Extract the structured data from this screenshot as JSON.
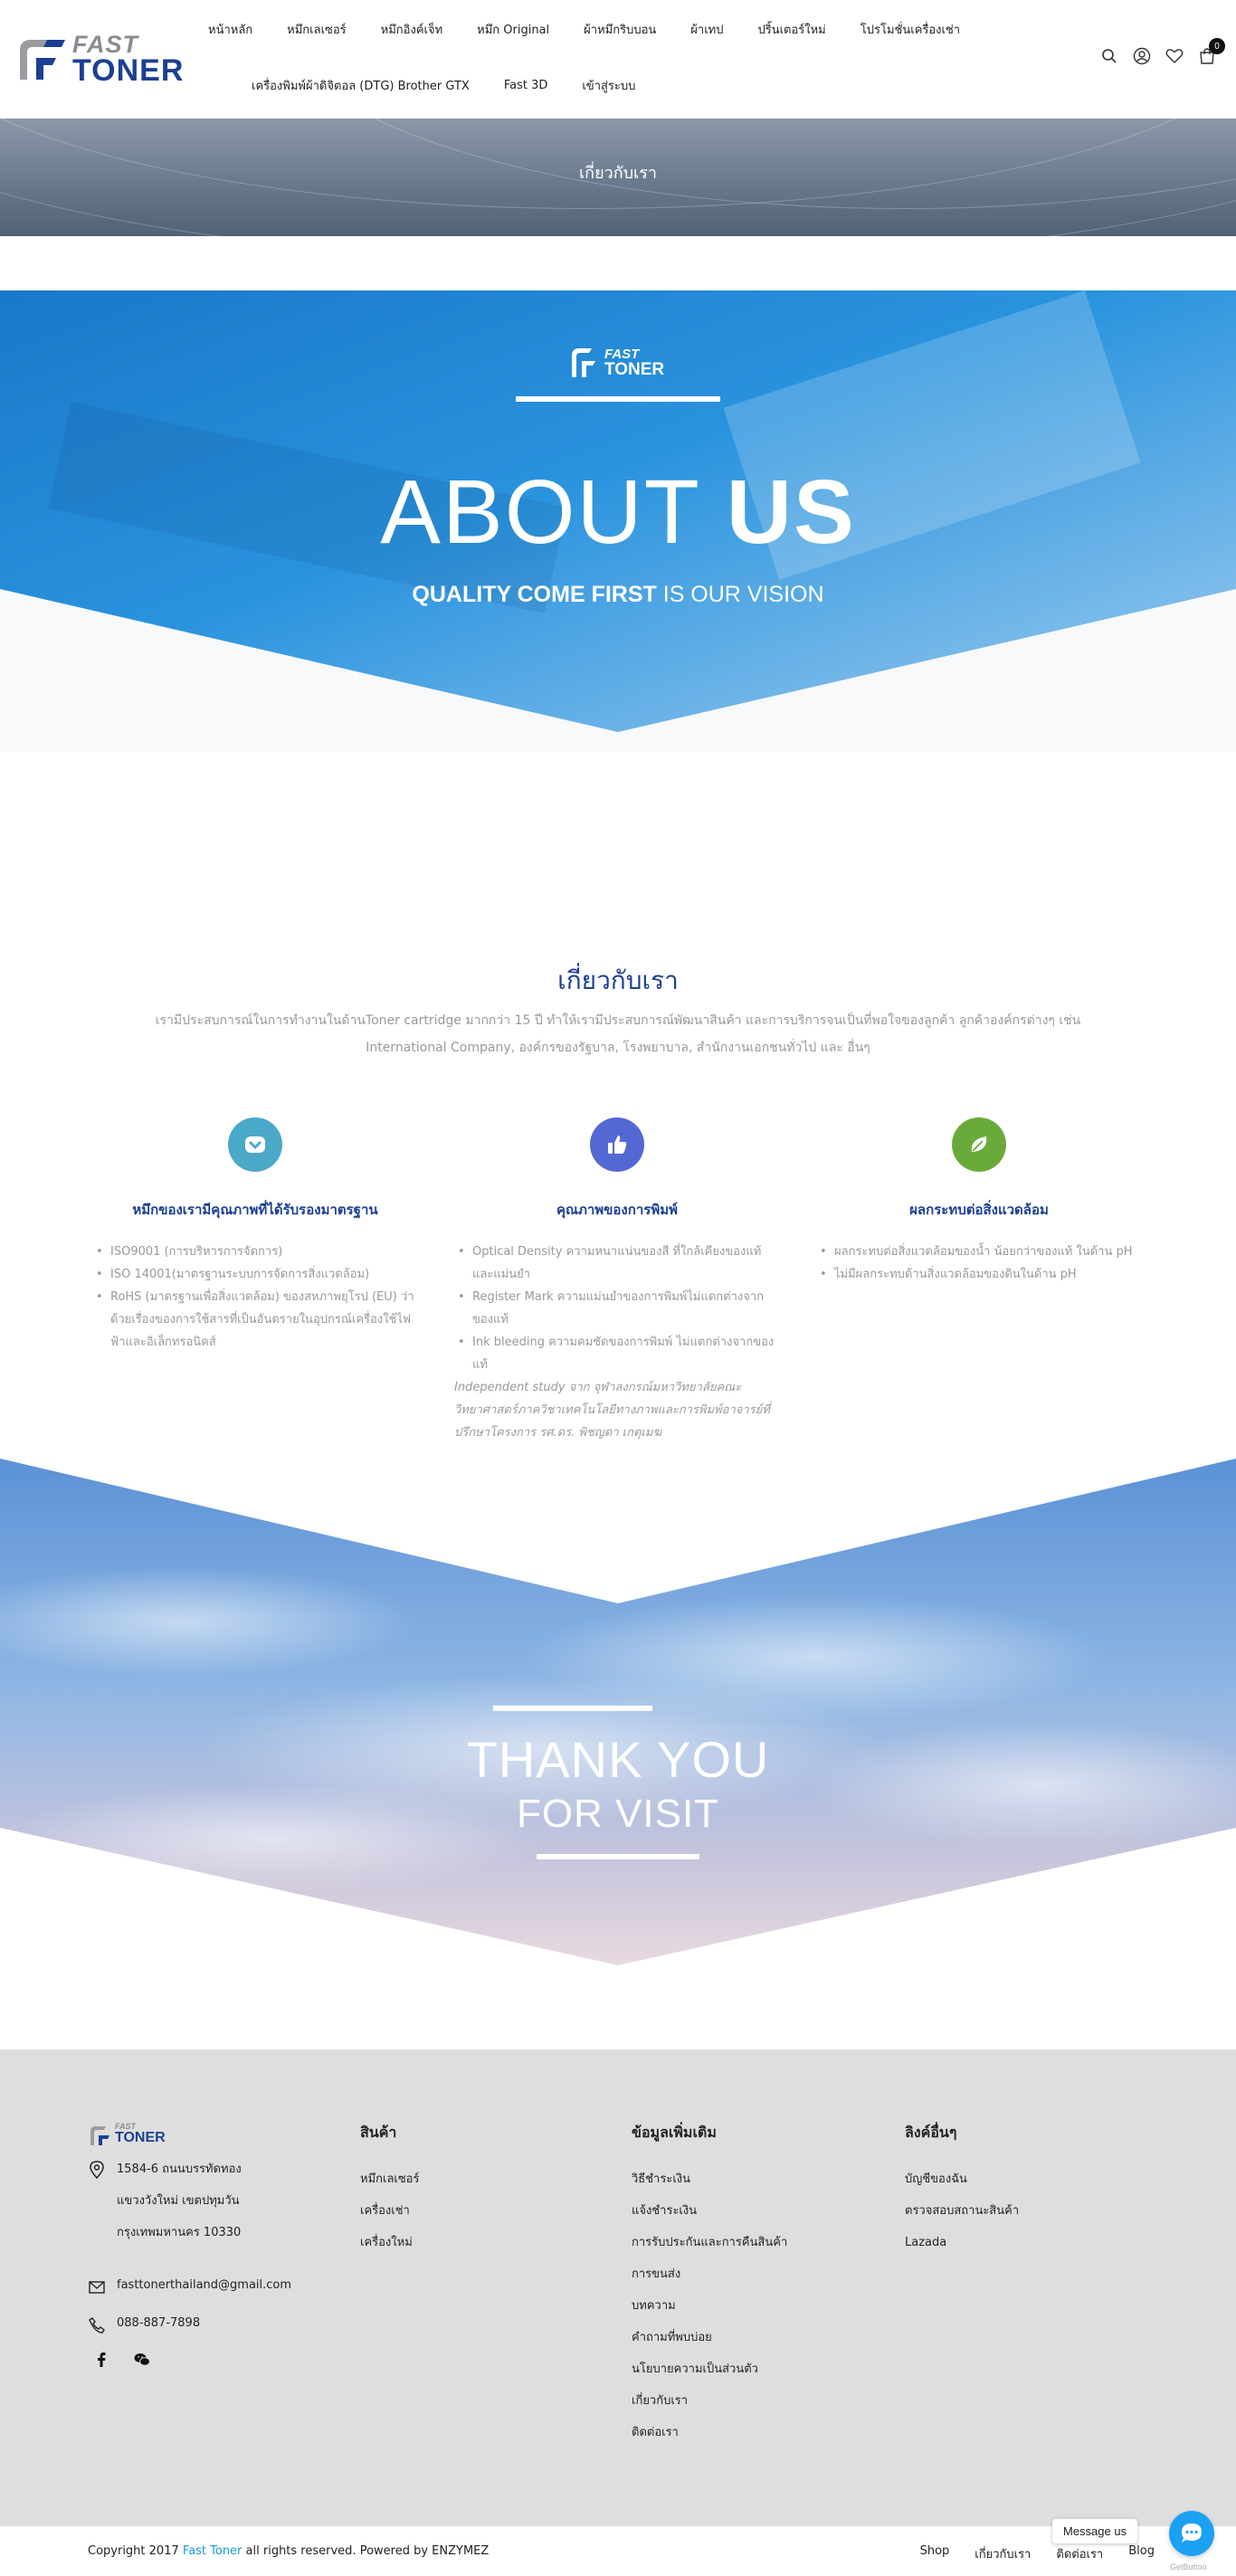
{
  "header": {
    "logo": {
      "fast": "FAST",
      "toner": "TONER"
    },
    "nav_row1": [
      "หน้าหลัก",
      "หมึกเลเซอร์",
      "หมึกอิงค์เจ็ท",
      "หมึก Original",
      "ผ้าหมึกริบบอน",
      "ผ้าเทป",
      "ปริ้นเตอร์ใหม่",
      "โปรโมชั่นเครื่องเช่า"
    ],
    "nav_row2": [
      "เครื่องพิมพ์ผ้าดิจิตอล (DTG) Brother GTX",
      "Fast 3D",
      "เข้าสู่ระบบ"
    ],
    "cart_count": "0",
    "icons": [
      "search-icon",
      "user-icon",
      "heart-icon",
      "cart-icon"
    ]
  },
  "page_title": "เกี่ยวกับเรา",
  "about_banner": {
    "logo": {
      "fast": "FAST",
      "toner": "TONER"
    },
    "title_light": "ABOUT ",
    "title_bold": "US",
    "sub_bold": "QUALITY COME FIRST",
    "sub_light": " IS OUR VISION"
  },
  "about": {
    "title": "เกี่ยวกับเรา",
    "description": "เรามีประสบการณ์ในการทำงานในด้านToner cartridge มากกว่า 15 ปี ทำให้เรามีประสบการณ์พัฒนาสินค้า และการบริการจนเป็นที่พอใจของลูกค้า ลูกค้าองค์กรต่างๆ เช่น International Company, องค์กรของรัฐบาล, โรงพยาบาล, สำนักงานเอกชนทั่วไป และ อื่นๆ",
    "features": [
      {
        "icon": "shield-check-icon",
        "color": "#4aa9c9",
        "title": "หมึกของเรามีคุณภาพที่ได้รับรองมาตรฐาน",
        "items": [
          "ISO9001 (การบริหารการจัดการ)",
          "ISO 14001(มาตรฐานระบบการจัดการสิ่งแวดล้อม)",
          "RoHS (มาตรฐานเพื่อสิ่งแวดล้อม) ของสหภาพยุโรป (EU) ว่าด้วยเรื่องของการใช้สารที่เป็นอันตรายในอุปกรณ์เครื่องใช้ไฟฟ้าและอิเล็กทรอนิคส์"
        ],
        "note": ""
      },
      {
        "icon": "thumbs-up-icon",
        "color": "#5468d4",
        "title": "คุณภาพของการพิมพ์",
        "items": [
          "Optical Density ความหนาแน่นของสี ที่ใกล้เคียงของแท้ และแม่นยำ",
          "Register Mark ความแม่นยำของการพิมพ์ไม่แตกต่างจากของแท้",
          "Ink bleeding ความคมชัดของการพิมพ์ ไม่แตกต่างจากของแท้"
        ],
        "note": "Independent study จาก จุฬาลงกรณ์มหาวิทยาลัยคณะวิทยาศาสตร์ภาควิชาเทคโนโลยีทางภาพและการพิมพ์อาจารย์ที่ปรึกษาโครงการ รศ.ดร. พิชญดา เกตุเมฆ"
      },
      {
        "icon": "leaf-icon",
        "color": "#6aaa3a",
        "title": "ผลกระทบต่อสิ่งแวดล้อม",
        "items": [
          "ผลกระทบต่อสิ่งแวดล้อมของน้ำ น้อยกว่าของแท้ ในด้าน pH",
          "ไม่มีผลกระทบด้านสิ่งแวดล้อมของดินในด้าน pH"
        ],
        "note": ""
      }
    ]
  },
  "thanks": {
    "title": "THANK YOU",
    "sub": "FOR VISIT"
  },
  "footer": {
    "logo": {
      "fast": "FAST",
      "toner": "TONER"
    },
    "address_lines": [
      "1584-6 ถนนบรรทัดทอง",
      "แขวงวังใหม่ เขตปทุมวัน",
      "กรุงเทพมหานคร 10330"
    ],
    "email": "fasttonerthailand@gmail.com",
    "phone": "088-887-7898",
    "social": [
      "facebook-icon",
      "wechat-icon"
    ],
    "columns": [
      {
        "title": "สินค้า",
        "links": [
          "หมึกเลเซอร์",
          "เครื่องเช่า",
          "เครื่องใหม่"
        ]
      },
      {
        "title": "ข้อมูลเพิ่มเติม",
        "links": [
          "วิธีชำระเงิน",
          "แจ้งชำระเงิน",
          "การรับประกันและการคืนสินค้า",
          "การขนส่ง",
          "บทความ",
          "คำถามที่พบบ่อย",
          "นโยบายความเป็นส่วนตัว",
          "เกี่ยวกับเรา",
          "ติดต่อเรา"
        ]
      },
      {
        "title": "ลิงค์อื่นๆ",
        "links": [
          "บัญชีของฉัน",
          "ตรวจสอบสถานะสินค้า",
          "Lazada"
        ]
      }
    ]
  },
  "bottom": {
    "copyright_prefix": "Copyright 2017 ",
    "copyright_brand": "Fast Toner",
    "copyright_suffix": " all rights reserved. Powered by ENZYMEZ",
    "links": [
      "Shop",
      "เกี่ยวกับเรา",
      "ติดต่อเรา",
      "Blog"
    ]
  },
  "chat": {
    "message": "Message us",
    "brand": "GetButton"
  }
}
